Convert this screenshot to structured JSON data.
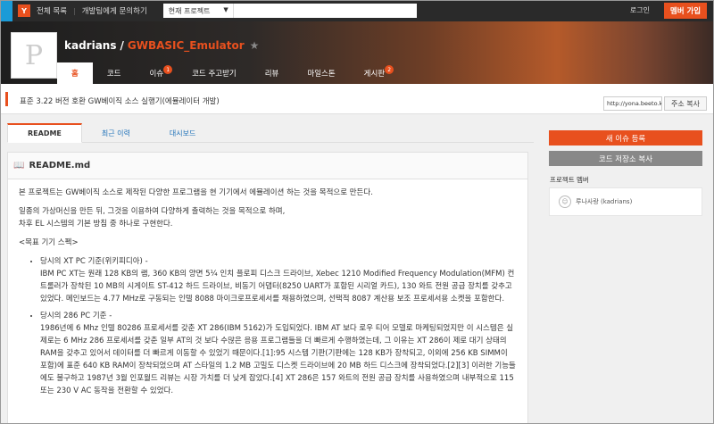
{
  "topbar": {
    "logo_letter": "Y",
    "links": [
      "전체 목록",
      "개발팀에게 문의하기"
    ],
    "project_select": "현재 프로젝트",
    "login": "로그인",
    "signup": "멤버 가입"
  },
  "header": {
    "owner": "kadrians",
    "repo": "GWBASIC_Emulator",
    "avatar_letter": "P"
  },
  "nav": [
    {
      "label": "홈",
      "count": ""
    },
    {
      "label": "코드",
      "count": ""
    },
    {
      "label": "이슈",
      "count": "1"
    },
    {
      "label": "코드 주고받기",
      "count": ""
    },
    {
      "label": "리뷰",
      "count": ""
    },
    {
      "label": "마일스톤",
      "count": ""
    },
    {
      "label": "게시판",
      "count": "2"
    }
  ],
  "description": "표준 3.22 버전 호환 GW베이직 소스 실행기(에뮬레이터 개발)",
  "clone": {
    "url": "http://yona.beeto.kr",
    "copy_label": "주소 복사"
  },
  "tabs": [
    "README",
    "최근 이력",
    "대시보드"
  ],
  "readme": {
    "title": "README.md",
    "p1": "본 프로젝트는 GW베이직 소스로 제작된 다양한 프로그램을 현 기기에서 에뮬레이션 하는 것을 목적으로 만든다.",
    "p2a": "일종의 가상머신을 만든 뒤, 그것을 이용하여 다양하게 출력하는 것을 목적으로 하며,",
    "p2b": "차후 EL 시스템의 기본 방침 중 하나로 구현한다.",
    "p3": "<목표 기기 스펙>",
    "item1_title": "당시의 XT PC 기준(위키피디아) -",
    "item1_body": "IBM PC XT는 원래 128 KB의 램, 360 KB의 양면 5¼ 인치 플로피 디스크 드라이브, Xebec 1210 Modified Frequency Modulation(MFM) 컨트롤러가 장착된 10 MB의 시게이트 ST-412 하드 드라이브, 비동기 어댑터(8250 UART가 포함된 시리얼 카드), 130 와트 전원 공급 장치를 갖추고 있었다. 메인보드는 4.77 MHz로 구동되는 인텔 8088 마이크로프로세서를 채용하였으며, 선택적 8087 계산용 보조 프로세서용 소켓을 포함한다.",
    "item2_title": "당시의 286 PC 기준 -",
    "item2_body": "1986년에 6 Mhz 인텔 80286 프로세서를 갖춘 XT 286(IBM 5162)가 도입되었다. IBM AT 보다 로우 티어 모델로 마케팅되었지만 이 시스템은 실제로는 6 MHz 286 프로세서를 갖춘 일부 AT의 것 보다 수많은 응용 프로그램들을 더 빠르게 수행하였는데, 그 이유는 XT 286이 제로 대기 상태의 RAM을 갖추고 있어서 데이터를 더 빠르게 이동할 수 있었기 때문이다.[1]:95 시스템 기판(기판에는 128 KB가 장착되고, 이외에 256 KB SIMM이 포함)에 표준 640 KB RAM이 장착되었으며 AT 스타일의 1.2 MB 고밀도 디스켓 드라이브에 20 MB 하드 디스크에 장착되었다.[2][3] 이러한 기능들에도 불구하고 1987년 3월 인포월드 리뷰는 시장 가치를 더 낮게 잡았다.[4] XT 286은 157 와트의 전원 공급 장치를 사용하였으며 내부적으로 115 또는 230 V AC 동작을 전환할 수 있었다."
  },
  "sidebar": {
    "new_issue": "새 이슈 등록",
    "copy_repo": "코드 저장소 복사",
    "members_title": "프로젝트 멤버",
    "member_name": "루나사랑 (kadrians)"
  },
  "colors": {
    "accent": "#e8501e",
    "link": "#1b6fb8",
    "topbar": "#2a2a2a"
  }
}
